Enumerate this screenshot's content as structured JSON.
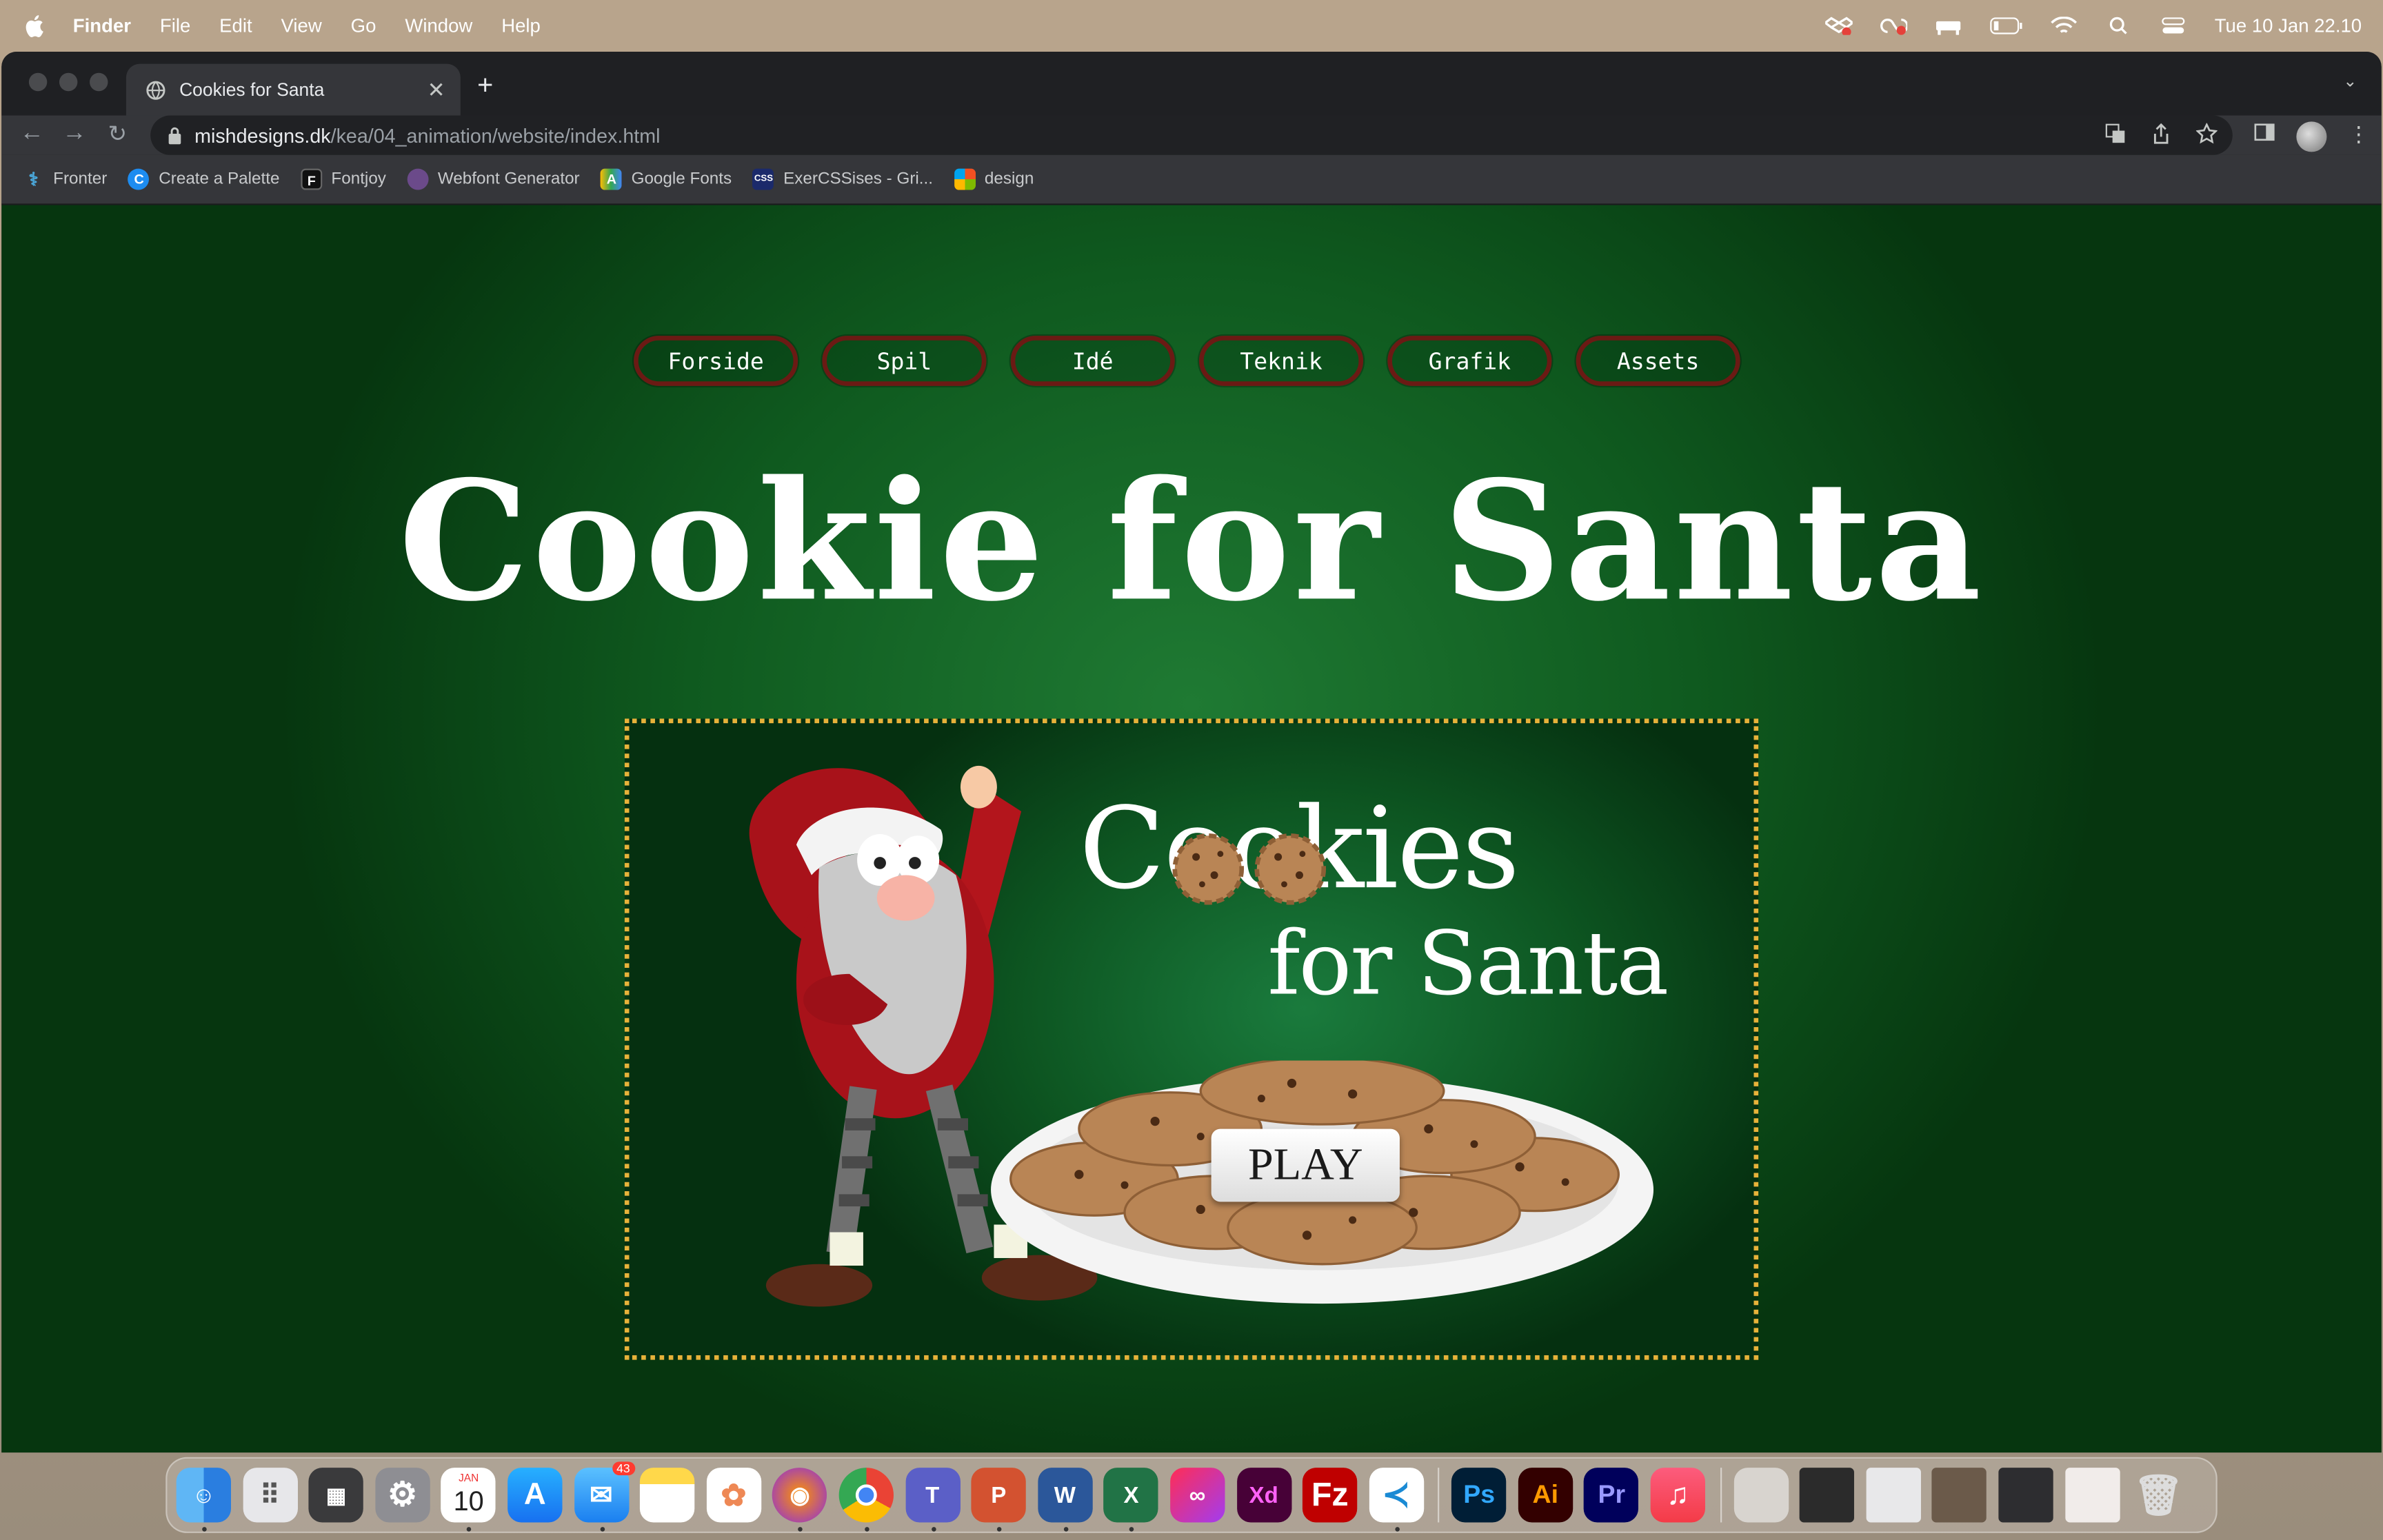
{
  "menubar": {
    "app": "Finder",
    "menus": [
      "File",
      "Edit",
      "View",
      "Go",
      "Window",
      "Help"
    ],
    "clock": "Tue 10 Jan  22.10"
  },
  "browser": {
    "tab_title": "Cookies for Santa",
    "url_host": "mishdesigns.dk",
    "url_path": "/kea/04_animation/website/index.html",
    "bookmarks": [
      "Fronter",
      "Create a Palette",
      "Fontjoy",
      "Webfont Generator",
      "Google Fonts",
      "ExerCSSises - Gri...",
      "design"
    ]
  },
  "page": {
    "nav": [
      "Forside",
      "Spil",
      "Idé",
      "Teknik",
      "Grafik",
      "Assets"
    ],
    "title": "Cookie for Santa",
    "game": {
      "logo_line1": "Cookies",
      "logo_line2": "for Santa",
      "play_label": "PLAY"
    }
  },
  "dock": {
    "calendar_month": "JAN",
    "calendar_day": "10",
    "mail_badge": "43",
    "apps": [
      "finder",
      "launchpad",
      "calculator",
      "system-settings",
      "calendar",
      "app-store",
      "mail",
      "notes",
      "photos",
      "firefox",
      "chrome",
      "teams",
      "powerpoint",
      "word",
      "excel",
      "creative-cloud",
      "adobe-xd",
      "filezilla",
      "vscode",
      "photoshop",
      "illustrator",
      "premiere",
      "music"
    ],
    "labels": {
      "xd": "Xd",
      "ps": "Ps",
      "ai": "Ai",
      "pr": "Pr"
    }
  },
  "colors": {
    "page_green": "#0f5a1f",
    "nav_border": "#6b1a14",
    "game_border": "#e7b23a"
  }
}
